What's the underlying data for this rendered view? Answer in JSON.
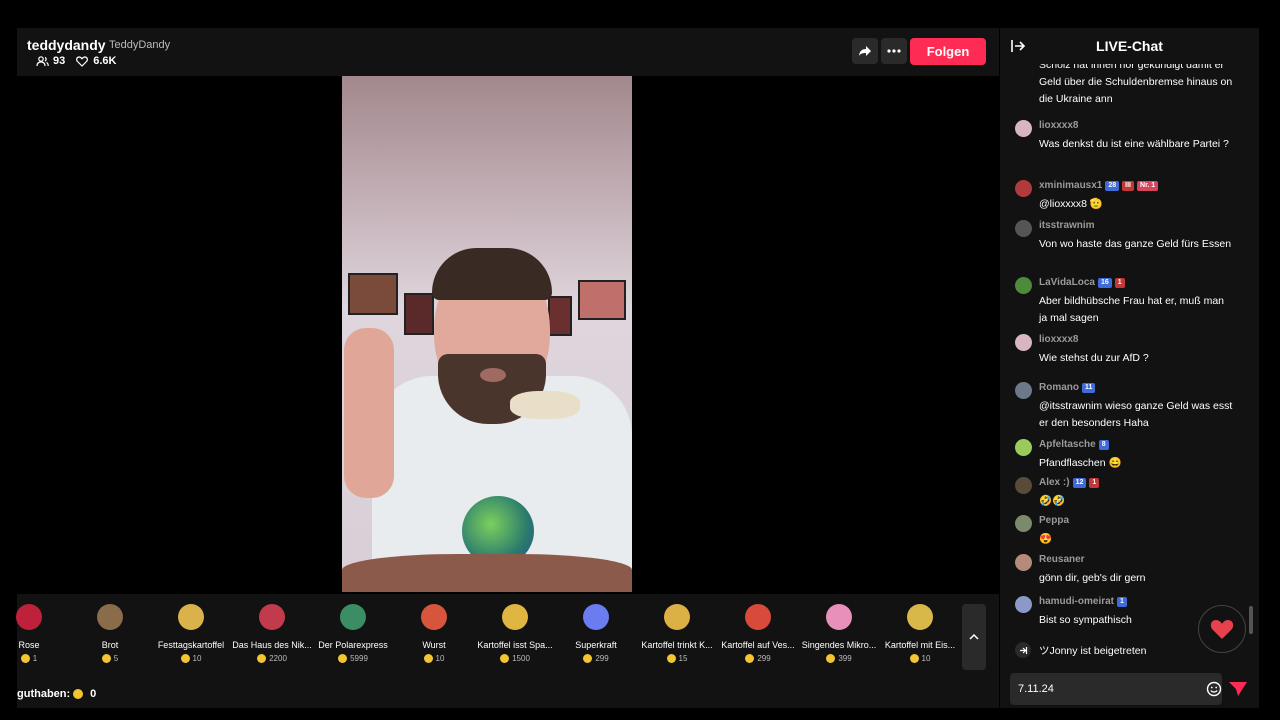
{
  "header": {
    "streamer_name": "teddydandy",
    "streamer_handle": "TeddyDandy",
    "viewers": "93",
    "likes": "6.6K",
    "follow_label": "Folgen"
  },
  "gifts": [
    {
      "name": "Rose",
      "price": "1",
      "icon": "rose-icon",
      "color": "#c0213a"
    },
    {
      "name": "Brot",
      "price": "5",
      "icon": "bread-icon",
      "color": "#8a6b4a"
    },
    {
      "name": "Festtagskartoffel",
      "price": "10",
      "icon": "potato-icon",
      "color": "#d9b24a"
    },
    {
      "name": "Das Haus des Nik...",
      "price": "2200",
      "icon": "house-icon",
      "color": "#c23b4d"
    },
    {
      "name": "Der Polarexpress",
      "price": "5999",
      "icon": "train-icon",
      "color": "#3b8d63"
    },
    {
      "name": "Wurst",
      "price": "10",
      "icon": "sausage-icon",
      "color": "#d7553a"
    },
    {
      "name": "Kartoffel isst Spa...",
      "price": "1500",
      "icon": "potato-icon",
      "color": "#e0b642"
    },
    {
      "name": "Superkraft",
      "price": "299",
      "icon": "hand-icon",
      "color": "#6a7cf0"
    },
    {
      "name": "Kartoffel trinkt K...",
      "price": "15",
      "icon": "potato-icon",
      "color": "#dcb045"
    },
    {
      "name": "Kartoffel auf Ves...",
      "price": "299",
      "icon": "scooter-icon",
      "color": "#d84a3a"
    },
    {
      "name": "Singendes Mikro...",
      "price": "399",
      "icon": "microphone-icon",
      "color": "#e790b9"
    },
    {
      "name": "Kartoffel mit Eis...",
      "price": "10",
      "icon": "potato-icon",
      "color": "#d9b84a"
    }
  ],
  "balance": {
    "label": "guthaben:",
    "value": "0"
  },
  "chat": {
    "title": "LIVE-Chat",
    "partial_message": "Scholz hat ihnen nor gekündigt damit er Geld über die Schuldenbremse hinaus on die Ukraine ann",
    "messages": [
      {
        "user": "lioxxxx8",
        "text": "Was denkst du ist eine wählbare Partei ?",
        "badges": [],
        "avatar_color": "#d8b5c0"
      },
      {
        "user": "xminimausx1",
        "text": "@lioxxxx8 🫡",
        "badges": [
          {
            "text": "28",
            "type": "blue"
          },
          {
            "text": "III",
            "type": "red"
          },
          {
            "text": "Nr. 1",
            "type": "pink"
          }
        ],
        "avatar_color": "#b33a3a"
      },
      {
        "user": "itsstrawnim",
        "text": "Von wo haste das ganze Geld fürs Essen",
        "badges": [],
        "avatar_color": "#555555"
      },
      {
        "user": "LaVidaLoca",
        "text": "Aber bildhübsche Frau hat er, muß man ja mal sagen",
        "badges": [
          {
            "text": "16",
            "type": "blue"
          },
          {
            "text": "1",
            "type": "red"
          }
        ],
        "avatar_color": "#4c8a3c"
      },
      {
        "user": "lioxxxx8",
        "text": "Wie stehst du zur AfD ?",
        "badges": [],
        "avatar_color": "#d8b5c0"
      },
      {
        "user": "Romano",
        "text": "@itsstrawnim wieso ganze Geld was esst er den besonders Haha",
        "badges": [
          {
            "text": "11",
            "type": "blue"
          }
        ],
        "avatar_color": "#6a7a8a"
      },
      {
        "user": "Apfeltasche",
        "text": "Pfandflaschen 😄",
        "badges": [
          {
            "text": "8",
            "type": "blue"
          }
        ],
        "avatar_color": "#9acb5a"
      },
      {
        "user": "Alex :)",
        "text": "🤣🤣",
        "badges": [
          {
            "text": "12",
            "type": "blue"
          },
          {
            "text": "1",
            "type": "red"
          }
        ],
        "avatar_color": "#5a4a3a"
      },
      {
        "user": "Peppa",
        "text": "😍",
        "badges": [],
        "avatar_color": "#7a8a6a"
      },
      {
        "user": "Reusaner",
        "text": "gönn dir, geb's dir gern",
        "badges": [],
        "avatar_color": "#b58a7a"
      },
      {
        "user": "hamudi-omeirat",
        "text": "Bist so sympathisch",
        "badges": [
          {
            "text": "1",
            "type": "blue"
          }
        ],
        "avatar_color": "#8a9ac8"
      }
    ],
    "joined_user": "ツJonny",
    "joined_text": "ist beigetreten",
    "input_value": "7.11.24"
  },
  "colors": {
    "accent": "#fe2c55",
    "background": "#121212"
  }
}
